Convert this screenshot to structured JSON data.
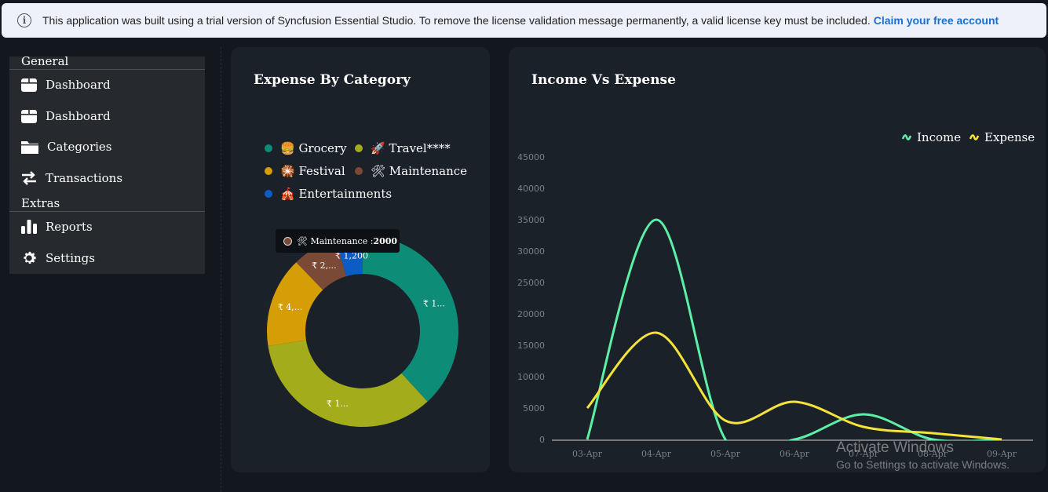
{
  "banner": {
    "message": "This application was built using a trial version of Syncfusion Essential Studio. To remove the license validation message permanently, a valid license key must be included.",
    "link": "Claim your free account",
    "icon": "info-icon"
  },
  "sidebar": {
    "general_title": "General",
    "extras_title": "Extras",
    "items": [
      {
        "label": "Dashboard",
        "icon": "box-icon"
      },
      {
        "label": "Dashboard",
        "icon": "box-icon"
      },
      {
        "label": "Categories",
        "icon": "folder-icon"
      },
      {
        "label": "Transactions",
        "icon": "arrows-icon"
      },
      {
        "label": "Reports",
        "icon": "bar-chart-icon"
      },
      {
        "label": "Settings",
        "icon": "gear-icon"
      }
    ]
  },
  "expense_card": {
    "title": "Expense By Category",
    "legend": [
      {
        "label": "🍔 Grocery",
        "color": "#0d8d78"
      },
      {
        "label": "🚀 Travel****",
        "color": "#a3ac1a"
      },
      {
        "label": "🎇 Festival",
        "color": "#d69e06"
      },
      {
        "label": "🛠 Maintenance",
        "color": "#7a4a36"
      },
      {
        "label": "🎪 Entertainments",
        "color": "#0b5dc5"
      }
    ],
    "tooltip": {
      "label": "🛠 Maintenance : ",
      "value": "2000"
    },
    "slice_labels": [
      "₹ 1...",
      "₹ 1...",
      "₹ 4,...",
      "₹ 2,...",
      "₹ 1,200"
    ]
  },
  "income_card": {
    "title": "Income Vs Expense"
  },
  "chart_data": [
    {
      "type": "pie",
      "title": "Expense By Category",
      "categories": [
        "Grocery",
        "Travel****",
        "Festival",
        "Maintenance",
        "Entertainments"
      ],
      "values": [
        10000,
        9000,
        4000,
        2000,
        1200
      ],
      "colors": [
        "#0d8d78",
        "#a3ac1a",
        "#d69e06",
        "#7a4a36",
        "#0b5dc5"
      ]
    },
    {
      "type": "line",
      "title": "Income Vs Expense",
      "categories": [
        "03-Apr",
        "04-Apr",
        "05-Apr",
        "06-Apr",
        "07-Apr",
        "08-Apr",
        "09-Apr"
      ],
      "series": [
        {
          "name": "Income",
          "values": [
            0,
            35000,
            0,
            0,
            4000,
            0,
            0
          ],
          "color": "#5cf0a6"
        },
        {
          "name": "Expense",
          "values": [
            5000,
            17000,
            3000,
            6000,
            2000,
            1000,
            0
          ],
          "color": "#f5e33a"
        }
      ],
      "yticks": [
        "0",
        "5000",
        "10000",
        "15000",
        "20000",
        "25000",
        "30000",
        "35000",
        "40000",
        "45000"
      ],
      "ylim": [
        0,
        45000
      ],
      "legend": "top-right"
    }
  ],
  "watermark": {
    "line1": "Activate Windows",
    "line2": "Go to Settings to activate Windows."
  }
}
